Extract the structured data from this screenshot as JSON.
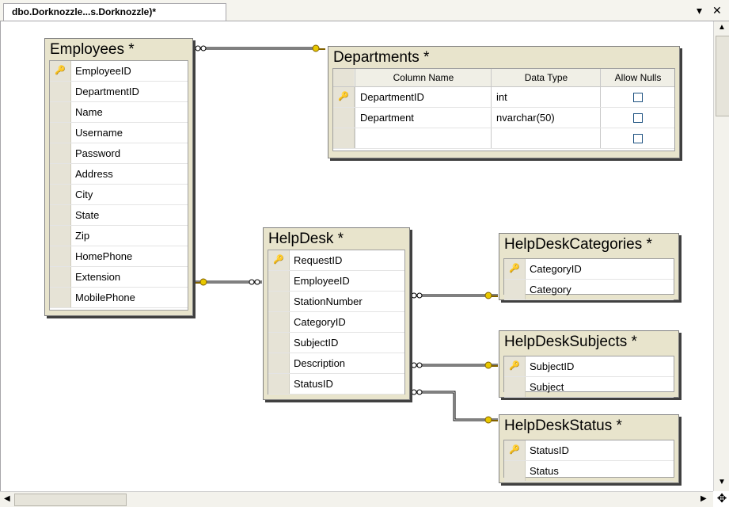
{
  "tab": {
    "title": "dbo.Dorknozzle...s.Dorknozzle)*",
    "dropdown_glyph": "▾",
    "close_glyph": "✕"
  },
  "tables": {
    "employees": {
      "title": "Employees *",
      "columns": [
        "EmployeeID",
        "DepartmentID",
        "Name",
        "Username",
        "Password",
        "Address",
        "City",
        "State",
        "Zip",
        "HomePhone",
        "Extension",
        "MobilePhone"
      ],
      "key": "EmployeeID"
    },
    "departments": {
      "title": "Departments *",
      "headers": [
        "Column Name",
        "Data Type",
        "Allow Nulls"
      ],
      "rows": [
        {
          "name": "DepartmentID",
          "type": "int",
          "key": true
        },
        {
          "name": "Department",
          "type": "nvarchar(50)",
          "key": false
        },
        {
          "name": "",
          "type": "",
          "key": false
        }
      ]
    },
    "helpdesk": {
      "title": "HelpDesk *",
      "columns": [
        "RequestID",
        "EmployeeID",
        "StationNumber",
        "CategoryID",
        "SubjectID",
        "Description",
        "StatusID"
      ],
      "key": "RequestID"
    },
    "helpdesk_categories": {
      "title": "HelpDeskCategories *",
      "columns": [
        "CategoryID",
        "Category"
      ],
      "key": "CategoryID"
    },
    "helpdesk_subjects": {
      "title": "HelpDeskSubjects *",
      "columns": [
        "SubjectID",
        "Subject"
      ],
      "key": "SubjectID"
    },
    "helpdesk_status": {
      "title": "HelpDeskStatus *",
      "columns": [
        "StatusID",
        "Status"
      ],
      "key": "StatusID"
    }
  },
  "icons": {
    "key": "key-icon",
    "checkbox": "checkbox-icon"
  },
  "colors": {
    "table_bg": "#e8e4cc",
    "key_color": "#b58b00"
  }
}
